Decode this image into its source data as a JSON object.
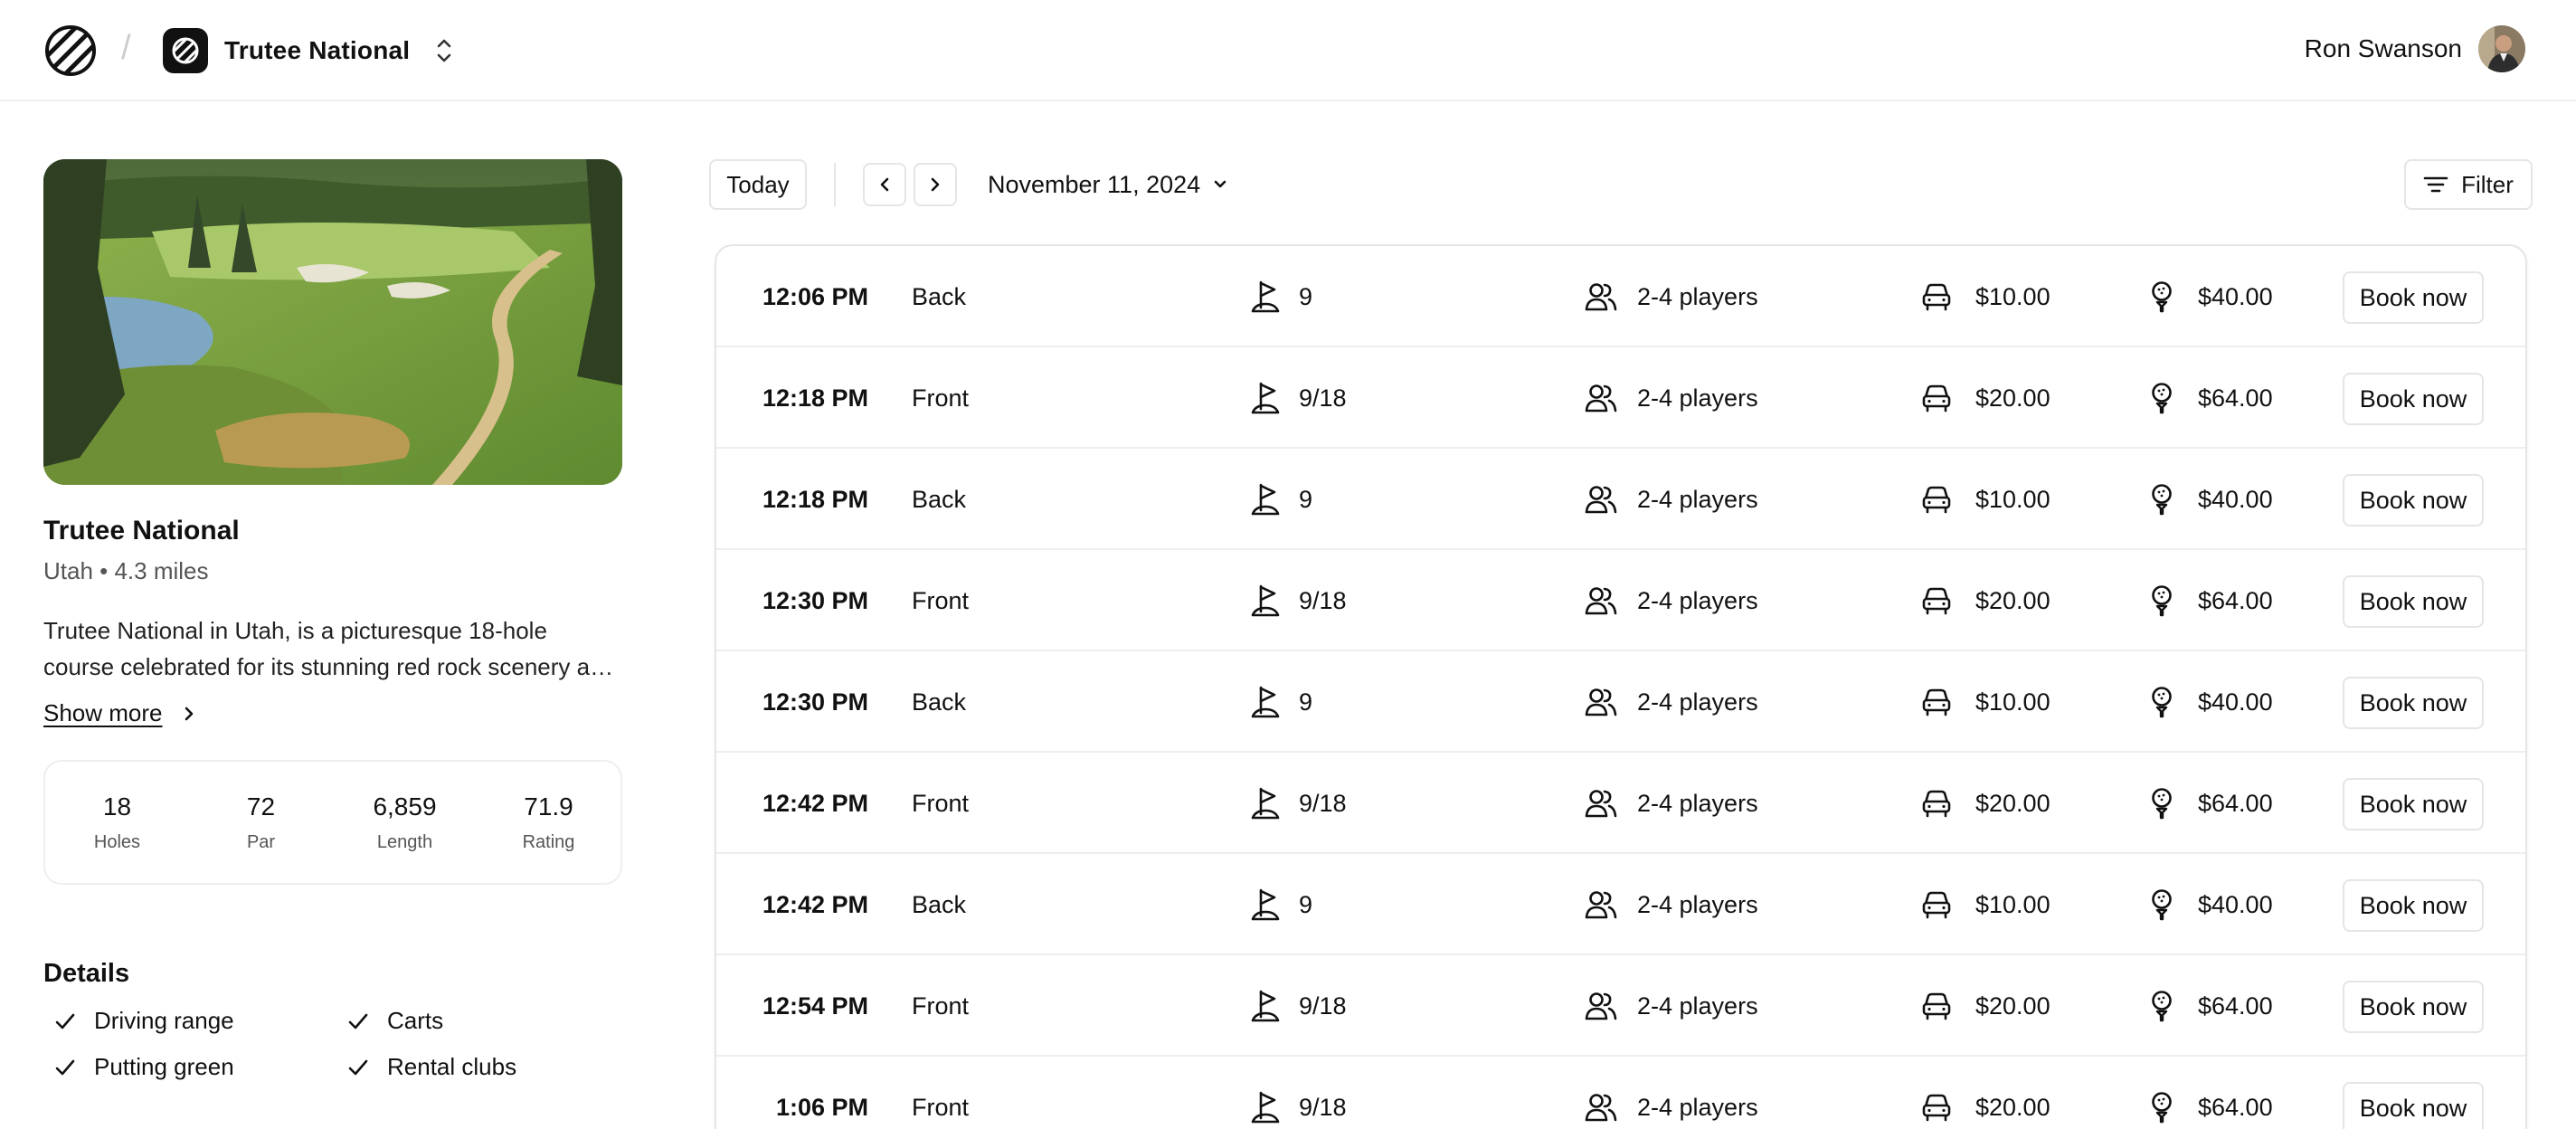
{
  "header": {
    "logo_icon": "striped-circle-logo-icon",
    "course_name": "Trutee National",
    "user_name": "Ron Swanson"
  },
  "course": {
    "name": "Trutee National",
    "subtitle": "Utah • 4.3 miles",
    "description": "Trutee National in Utah, is a picturesque 18-hole course celebrated for its stunning red rock scenery and challenging play.",
    "show_more": "Show more",
    "stats": [
      {
        "value": "18",
        "label": "Holes"
      },
      {
        "value": "72",
        "label": "Par"
      },
      {
        "value": "6,859",
        "label": "Length"
      },
      {
        "value": "71.9",
        "label": "Rating"
      }
    ],
    "details_title": "Details",
    "amenities": [
      "Driving range",
      "Carts",
      "Putting green",
      "Rental clubs"
    ]
  },
  "toolbar": {
    "today": "Today",
    "date": "November 11, 2024",
    "filter": "Filter"
  },
  "tee_times": [
    {
      "time": "12:06 PM",
      "side": "Back",
      "holes": "9",
      "players": "2-4 players",
      "cart": "$10.00",
      "green": "$40.00",
      "book": "Book now"
    },
    {
      "time": "12:18 PM",
      "side": "Front",
      "holes": "9/18",
      "players": "2-4 players",
      "cart": "$20.00",
      "green": "$64.00",
      "book": "Book now"
    },
    {
      "time": "12:18 PM",
      "side": "Back",
      "holes": "9",
      "players": "2-4 players",
      "cart": "$10.00",
      "green": "$40.00",
      "book": "Book now"
    },
    {
      "time": "12:30 PM",
      "side": "Front",
      "holes": "9/18",
      "players": "2-4 players",
      "cart": "$20.00",
      "green": "$64.00",
      "book": "Book now"
    },
    {
      "time": "12:30 PM",
      "side": "Back",
      "holes": "9",
      "players": "2-4 players",
      "cart": "$10.00",
      "green": "$40.00",
      "book": "Book now"
    },
    {
      "time": "12:42 PM",
      "side": "Front",
      "holes": "9/18",
      "players": "2-4 players",
      "cart": "$20.00",
      "green": "$64.00",
      "book": "Book now"
    },
    {
      "time": "12:42 PM",
      "side": "Back",
      "holes": "9",
      "players": "2-4 players",
      "cart": "$10.00",
      "green": "$40.00",
      "book": "Book now"
    },
    {
      "time": "12:54 PM",
      "side": "Front",
      "holes": "9/18",
      "players": "2-4 players",
      "cart": "$20.00",
      "green": "$64.00",
      "book": "Book now"
    },
    {
      "time": "1:06 PM",
      "side": "Front",
      "holes": "9/18",
      "players": "2-4 players",
      "cart": "$20.00",
      "green": "$64.00",
      "book": "Book now"
    }
  ]
}
